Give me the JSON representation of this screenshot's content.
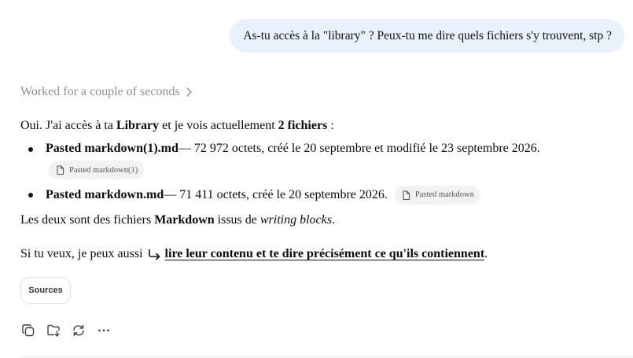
{
  "user_message": "As-tu accès à la \"library\" ? Peux-tu me dire quels fichiers s'y trouvent, stp ?",
  "worked_label": "Worked for a couple of seconds",
  "answer": {
    "intro_prefix": "Oui. J'ai accès à ta ",
    "intro_library": "Library",
    "intro_middle": " et je vois actuellement ",
    "intro_count": "2 fichiers",
    "intro_suffix": " :",
    "files": [
      {
        "name": "Pasted markdown(1).md",
        "details": " — 72 972 octets, créé le 20 septembre et modifié le 23 septembre 2026.",
        "chip_label": "Pasted markdown(1)"
      },
      {
        "name": "Pasted markdown.md",
        "details": " — 71 411 octets, créé le 20 septembre 2026.",
        "chip_label": "Pasted markdown"
      }
    ],
    "summary_prefix": "Les deux sont des fichiers ",
    "summary_type": "Markdown",
    "summary_middle": " issus de ",
    "summary_source": "writing blocks",
    "summary_suffix": ".",
    "offer_prefix": "Si tu veux, je peux aussi",
    "offer_link": "lire leur contenu et te dire précisément ce qu'ils contiennent",
    "offer_suffix": "."
  },
  "sources_label": "Sources",
  "icons": {
    "worked": "chevron-right-icon",
    "file_chip": "document-icon",
    "offer": "return-arrow-icon",
    "actions": [
      "copy-icon",
      "save-to-folder-icon",
      "regenerate-icon",
      "more-icon"
    ]
  }
}
